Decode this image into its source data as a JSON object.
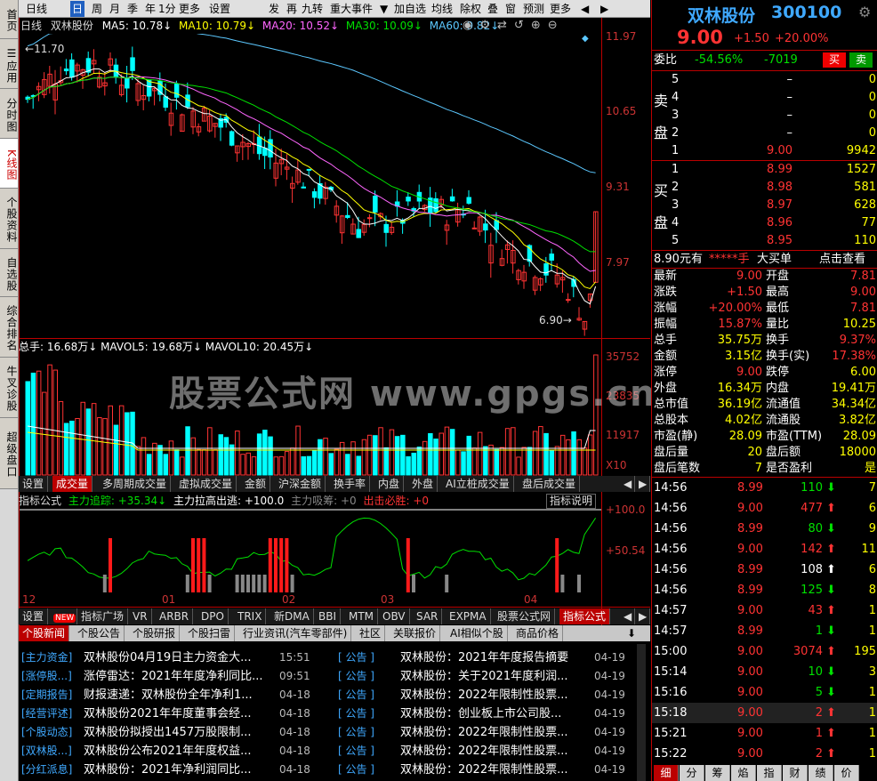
{
  "sidebar": {
    "tabs": [
      "首页",
      "应用",
      "分时图",
      "K线图",
      "个股资料",
      "自选股",
      "综合排名",
      "牛叉诊股",
      "超级盘口"
    ]
  },
  "toolbar": {
    "left": [
      "日线",
      "日",
      "周",
      "月",
      "季",
      "年",
      "1分",
      "更多",
      "设置"
    ],
    "right": [
      "发",
      "再",
      "九转",
      "重大事件",
      "▼",
      "加自选",
      "均线",
      "除权",
      "叠",
      "窗",
      "预测",
      "更多",
      "◀",
      "▶"
    ]
  },
  "ma": {
    "period": "日线",
    "name": "双林股份",
    "ma5": "MA5: 10.78↓",
    "ma10": "MA10: 10.79↓",
    "ma20": "MA20: 10.52↓",
    "ma30": "MA30: 10.09↓",
    "ma60": "MA60: 9.82↓"
  },
  "price_axis": [
    "11.97",
    "10.65",
    "9.31",
    "7.97"
  ],
  "kline": {
    "high_label": "11.70",
    "low_label": "6.90"
  },
  "volume": {
    "line": "总手: 16.68万↓  MAVOL5: 19.68万↓  MAVOL10: 20.45万↓",
    "axis": [
      "35752",
      "23835",
      "11917",
      "X10"
    ]
  },
  "volume_tabs": [
    "设置",
    "成交量",
    "多周期成交量",
    "虚拟成交量",
    "金额",
    "沪深金额",
    "换手率",
    "内盘",
    "外盘",
    "AI立桩成交量",
    "盘后成交量"
  ],
  "indicator": {
    "label": "指标公式",
    "zl": "主力追踪: +35.34↓",
    "lg": "主力拉高出逃: +100.0",
    "xc": "主力吸筹: +0",
    "cj": "出击必胜: +0",
    "help": "指标说明",
    "axis": [
      "+100.0",
      "+50.54"
    ]
  },
  "dates": [
    "12",
    "01",
    "02",
    "03",
    "04"
  ],
  "indicator_tabs": [
    "设置",
    "NEW",
    "指标广场",
    "VR",
    "ARBR",
    "DPO",
    "TRIX",
    "新DMA",
    "BBI",
    "MTM",
    "OBV",
    "SAR",
    "EXPMA",
    "股票公式网",
    "指标公式"
  ],
  "news_tabs": [
    "个股新闻",
    "个股公告",
    "个股研报",
    "个股扫雷",
    "行业资讯(汽车零部件)",
    "社区",
    "关联报价",
    "AI相似个股",
    "商品价格"
  ],
  "news_left": [
    {
      "tag": "[主力资金]",
      "title": "双林股份04月19日主力资金大...",
      "time": "15:51"
    },
    {
      "tag": "[涨停股...]",
      "title": "涨停雷达：2021年年度净利同比...",
      "time": "09:51"
    },
    {
      "tag": "[定期报告]",
      "title": "财报速递：双林股份全年净利1...",
      "time": "04-18"
    },
    {
      "tag": "[经营评述]",
      "title": "双林股份2021年年度董事会经...",
      "time": "04-18"
    },
    {
      "tag": "[个股动态]",
      "title": "双林股份拟授出1457万股限制...",
      "time": "04-18"
    },
    {
      "tag": "[双林股...]",
      "title": "双林股份公布2021年年度权益...",
      "time": "04-18"
    },
    {
      "tag": "[分红派息]",
      "title": "双林股份：2021年净利润同比...",
      "time": "04-18"
    }
  ],
  "news_right": [
    {
      "tag": "[    公告    ]",
      "title": "双林股份：2021年年度报告摘要",
      "time": "04-19"
    },
    {
      "tag": "[    公告    ]",
      "title": "双林股份：关于2021年度利润...",
      "time": "04-19"
    },
    {
      "tag": "[    公告    ]",
      "title": "双林股份：2022年限制性股票...",
      "time": "04-19"
    },
    {
      "tag": "[    公告    ]",
      "title": "双林股份：创业板上市公司股...",
      "time": "04-19"
    },
    {
      "tag": "[    公告    ]",
      "title": "双林股份：2022年限制性股票...",
      "time": "04-19"
    },
    {
      "tag": "[    公告    ]",
      "title": "双林股份：2022年限制性股票...",
      "time": "04-19"
    },
    {
      "tag": "[    公告    ]",
      "title": "双林股份：2022年限制性股票...",
      "time": "04-19"
    }
  ],
  "watermark": "股票公式网  www.gpgs.cn",
  "quote": {
    "name": "双林股份",
    "code": "300100",
    "price": "9.00",
    "change": "+1.50",
    "pct": "+20.00%",
    "weibi_label": "委比",
    "weibi": "-54.56%",
    "weicha": "-7019",
    "sell_btn": "买",
    "buy_btn": "卖",
    "sell_label": [
      "卖",
      "盘"
    ],
    "buy_label": [
      "买",
      "盘"
    ],
    "asks": [
      {
        "n": "5",
        "p": "–",
        "v": "0"
      },
      {
        "n": "4",
        "p": "–",
        "v": "0"
      },
      {
        "n": "3",
        "p": "–",
        "v": "0"
      },
      {
        "n": "2",
        "p": "–",
        "v": "0"
      },
      {
        "n": "1",
        "p": "9.00",
        "v": "9942"
      }
    ],
    "bids": [
      {
        "n": "1",
        "p": "8.99",
        "v": "1527"
      },
      {
        "n": "2",
        "p": "8.98",
        "v": "581"
      },
      {
        "n": "3",
        "p": "8.97",
        "v": "628"
      },
      {
        "n": "4",
        "p": "8.96",
        "v": "77"
      },
      {
        "n": "5",
        "p": "8.95",
        "v": "110"
      }
    ],
    "bigorder": {
      "price": "8.90元有",
      "hand": "*****手",
      "label": "大买单",
      "link": "点击查看"
    },
    "stats": [
      [
        "最新",
        "9.00",
        "开盘",
        "7.81"
      ],
      [
        "涨跌",
        "+1.50",
        "最高",
        "9.00"
      ],
      [
        "涨幅",
        "+20.00%",
        "最低",
        "7.81"
      ],
      [
        "振幅",
        "15.87%",
        "量比",
        "10.25"
      ],
      [
        "总手",
        "35.75万",
        "换手",
        "9.37%"
      ],
      [
        "金额",
        "3.15亿",
        "换手(实)",
        "17.38%"
      ],
      [
        "涨停",
        "9.00",
        "跌停",
        "6.00"
      ],
      [
        "外盘",
        "16.34万",
        "内盘",
        "19.41万"
      ],
      [
        "总市值",
        "36.19亿",
        "流通值",
        "34.34亿"
      ],
      [
        "总股本",
        "4.02亿",
        "流通股",
        "3.82亿"
      ],
      [
        "市盈(静)",
        "28.09",
        "市盈(TTM)",
        "28.09"
      ],
      [
        "盘后量",
        "20",
        "盘后额",
        "18000"
      ],
      [
        "盘后笔数",
        "7",
        "是否盈利",
        "是"
      ]
    ],
    "ticks": [
      {
        "t": "14:56",
        "p": "8.99",
        "v": "110",
        "d": "down",
        "n": "7"
      },
      {
        "t": "14:56",
        "p": "9.00",
        "v": "477",
        "d": "up",
        "n": "6"
      },
      {
        "t": "14:56",
        "p": "8.99",
        "v": "80",
        "d": "down",
        "n": "9"
      },
      {
        "t": "14:56",
        "p": "9.00",
        "v": "142",
        "d": "up",
        "n": "11"
      },
      {
        "t": "14:56",
        "p": "8.99",
        "v": "108",
        "d": "neutral",
        "n": "6"
      },
      {
        "t": "14:56",
        "p": "8.99",
        "v": "125",
        "d": "down",
        "n": "8"
      },
      {
        "t": "14:57",
        "p": "9.00",
        "v": "43",
        "d": "up",
        "n": "1"
      },
      {
        "t": "14:57",
        "p": "8.99",
        "v": "1",
        "d": "down",
        "n": "1"
      },
      {
        "t": "15:00",
        "p": "9.00",
        "v": "3074",
        "d": "up",
        "n": "195"
      },
      {
        "t": "15:14",
        "p": "9.00",
        "v": "10",
        "d": "down",
        "n": "3"
      },
      {
        "t": "15:16",
        "p": "9.00",
        "v": "5",
        "d": "down",
        "n": "1"
      },
      {
        "t": "15:18",
        "p": "9.00",
        "v": "2",
        "d": "up",
        "n": "1"
      },
      {
        "t": "15:21",
        "p": "9.00",
        "v": "1",
        "d": "up",
        "n": "1"
      },
      {
        "t": "15:22",
        "p": "9.00",
        "v": "2",
        "d": "up",
        "n": "1"
      }
    ],
    "bottom_tabs": [
      "细",
      "分",
      "筹",
      "焰",
      "指",
      "财",
      "绩",
      "价"
    ]
  }
}
